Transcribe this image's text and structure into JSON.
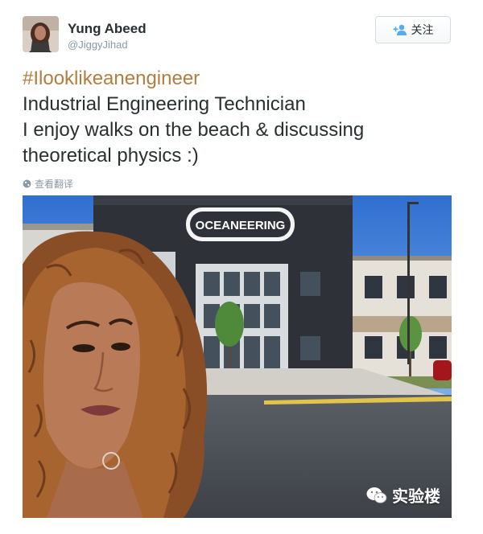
{
  "author": {
    "display_name": "Yung Abeed",
    "username": "@JiggyJihad"
  },
  "follow_button": {
    "label": "关注",
    "icon": "add-user-icon"
  },
  "tweet": {
    "hashtag": "#Ilooklikeanengineer",
    "lines": [
      "Industrial Engineering Technician",
      "I enjoy walks on the beach & discussing",
      "theoretical physics :)"
    ],
    "translate_label": "查看翻译"
  },
  "photo": {
    "building_sign": "OCEANEERING"
  },
  "watermark": {
    "label": "实验楼",
    "icon": "wechat-icon"
  },
  "colors": {
    "hashtag": "#b37d3d",
    "secondary_text": "#8899a6",
    "sky": "#3d7fd6"
  }
}
